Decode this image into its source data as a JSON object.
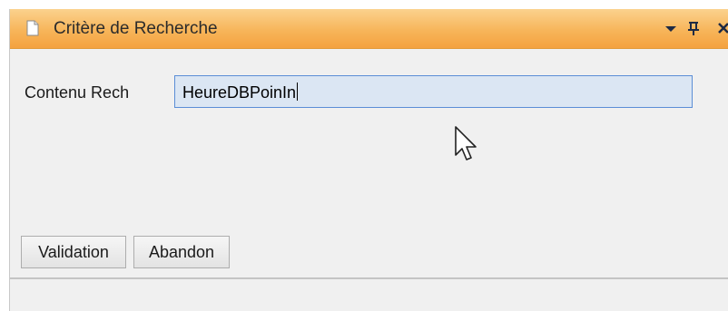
{
  "panel": {
    "title": "Critère de Recherche",
    "icons": {
      "document": "document-icon",
      "dropdown": "dropdown-arrow-icon",
      "pin": "pin-icon",
      "close": "close-icon"
    },
    "pin_glyph": "ᴨ",
    "close_glyph": "×",
    "dropdown_glyph": "▾"
  },
  "form": {
    "search_label": "Contenu Rech",
    "search_value": "HeureDBPoinIn"
  },
  "buttons": {
    "validation": "Validation",
    "abandon": "Abandon"
  },
  "colors": {
    "titlebar_orange": "#f4a23f",
    "input_focus_border": "#5b8ed6",
    "input_background": "#dbe6f3"
  }
}
